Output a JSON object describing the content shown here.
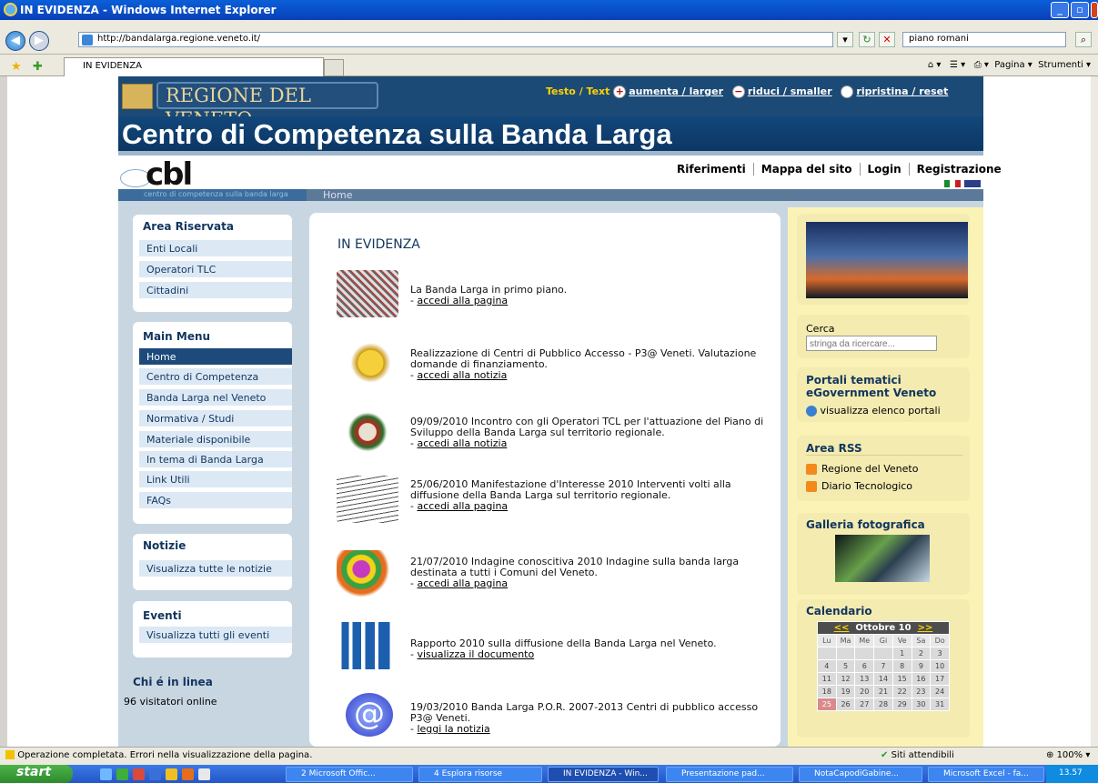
{
  "browser": {
    "title": "IN EVIDENZA - Windows Internet Explorer",
    "url": "http://bandalarga.regione.veneto.it/",
    "search_value": "piano romani",
    "tab_label": "IN EVIDENZA",
    "tools": [
      "Pagina",
      "Strumenti"
    ],
    "status_text": "Operazione completata. Errori nella visualizzazione della pagina.",
    "zone": "Siti attendibili",
    "zoom": "100%"
  },
  "site": {
    "regione": "REGIONE DEL VENETO",
    "text_label": "Testo / Text",
    "larger": "aumenta / larger",
    "smaller": "riduci / smaller",
    "reset": "ripristina / reset",
    "main_title": "Centro di Competenza sulla Banda Larga",
    "logo": "cbl",
    "logo_sub": "centro di competenza sulla banda larga",
    "topnav": [
      "Riferimenti",
      "Mappa del sito",
      "Login",
      "Registrazione"
    ],
    "breadcrumb": "Home"
  },
  "left": {
    "area_title": "Area Riservata",
    "area_items": [
      "Enti Locali",
      "Operatori TLC",
      "Cittadini"
    ],
    "menu_title": "Main Menu",
    "menu_items": [
      "Home",
      "Centro di Competenza",
      "Banda Larga nel Veneto",
      "Normativa / Studi",
      "Materiale disponibile",
      "In tema di Banda Larga",
      "Link Utili",
      "FAQs"
    ],
    "notizie_title": "Notizie",
    "notizie_link": "Visualizza tutte le notizie",
    "eventi_title": "Eventi",
    "eventi_link": "Visualizza tutti gli eventi",
    "online_title": "Chi é in linea",
    "online_text": "96 visitatori online"
  },
  "main": {
    "title": "IN EVIDENZA",
    "news": [
      {
        "text": "La Banda Larga in primo piano.",
        "link": "accedi alla pagina"
      },
      {
        "text": "Realizzazione di Centri di Pubblico Accesso - P3@ Veneti. Valutazione domande di finanziamento.",
        "link": "accedi alla notizia"
      },
      {
        "text": "09/09/2010 Incontro con gli Operatori TCL per l'attuazione del Piano di Sviluppo della Banda Larga sul territorio regionale.",
        "link": "accedi alla notizia"
      },
      {
        "text": "25/06/2010 Manifestazione d'Interesse 2010 Interventi volti alla diffusione della Banda Larga sul territorio regionale.",
        "link": "accedi alla pagina"
      },
      {
        "text": "21/07/2010 Indagine conoscitiva 2010 Indagine sulla banda larga destinata a tutti i Comuni del Veneto.",
        "link": "accedi alla pagina"
      },
      {
        "text": "Rapporto 2010 sulla diffusione della Banda Larga nel Veneto.",
        "link": "visualizza il documento"
      },
      {
        "text": "19/03/2010 Banda Larga P.O.R. 2007-2013 Centri di pubblico accesso P3@ Veneti.",
        "link": "leggi la notizia"
      }
    ]
  },
  "right": {
    "cerca_label": "Cerca",
    "cerca_placeholder": "stringa da ricercare...",
    "portali_title": "Portali tematici eGovernment Veneto",
    "portali_link": "visualizza elenco portali",
    "rss_title": "Area RSS",
    "rss_links": [
      "Regione del Veneto",
      "Diario Tecnologico"
    ],
    "galleria_title": "Galleria fotografica",
    "calendario_title": "Calendario",
    "cal_month": "Ottobre 10",
    "cal_prev": "<<",
    "cal_next": ">>",
    "cal_days": [
      "Lu",
      "Ma",
      "Me",
      "Gi",
      "Ve",
      "Sa",
      "Do"
    ],
    "cal_weeks": [
      [
        "",
        "",
        "",
        "",
        "1",
        "2",
        "3"
      ],
      [
        "4",
        "5",
        "6",
        "7",
        "8",
        "9",
        "10"
      ],
      [
        "11",
        "12",
        "13",
        "14",
        "15",
        "16",
        "17"
      ],
      [
        "18",
        "19",
        "20",
        "21",
        "22",
        "23",
        "24"
      ],
      [
        "25",
        "26",
        "27",
        "28",
        "29",
        "30",
        "31"
      ]
    ]
  },
  "taskbar": {
    "start": "start",
    "tasks": [
      "2 Microsoft Offic...",
      "4 Esplora risorse",
      "IN EVIDENZA - Win...",
      "Presentazione pad...",
      "NotaCapodiGabine...",
      "Microsoft Excel - fa..."
    ],
    "clock": "13.57"
  }
}
